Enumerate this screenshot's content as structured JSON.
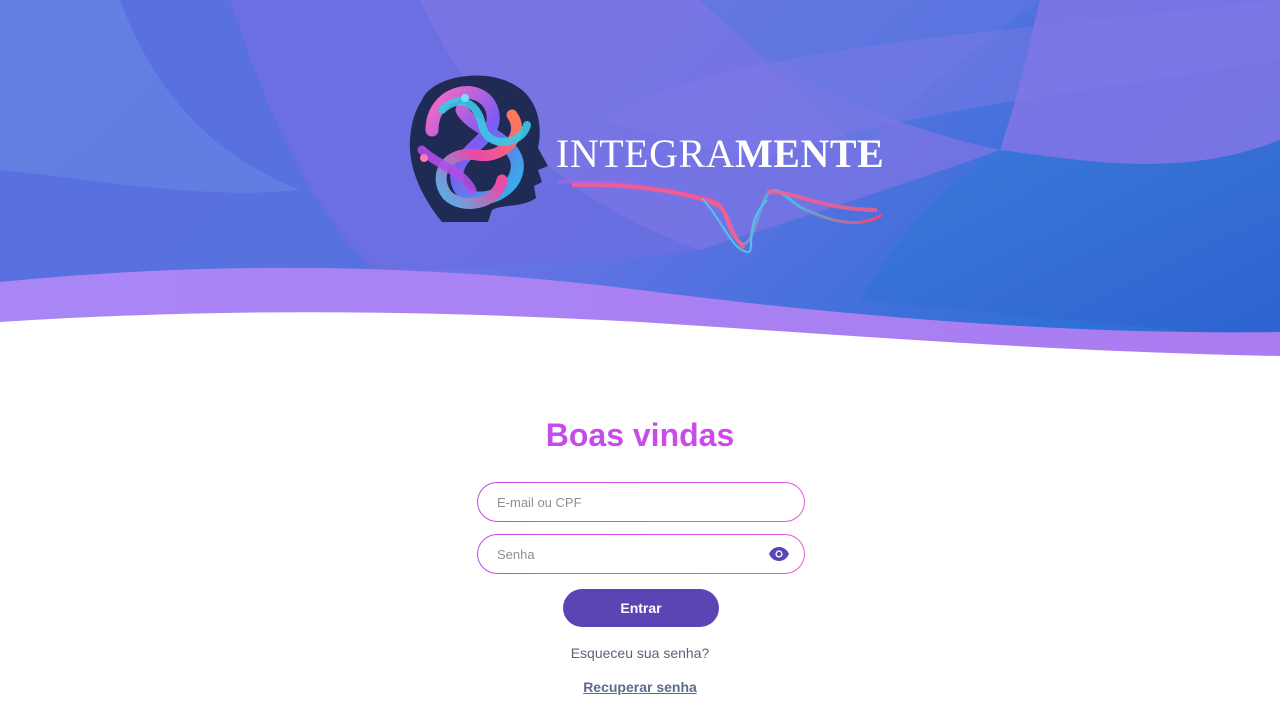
{
  "brand": {
    "name_light": "INTEGRA",
    "name_bold": "MENTE",
    "logo_icon": "brain-knot-icon",
    "colors": {
      "banner_top": "#7a78e8",
      "banner_blue": "#3a74d8",
      "wave_purple": "#a77ff0",
      "title_gradient_start": "#b24bf3",
      "title_gradient_end": "#e14bd0",
      "button": "#5b45b5"
    }
  },
  "login": {
    "title": "Boas vindas",
    "email_placeholder": "E-mail ou CPF",
    "email_value": "",
    "password_placeholder": "Senha",
    "password_value": "",
    "toggle_password_icon": "eye-icon",
    "submit_label": "Entrar",
    "forgot_text": "Esqueceu sua senha?",
    "recover_link": "Recuperar senha"
  }
}
